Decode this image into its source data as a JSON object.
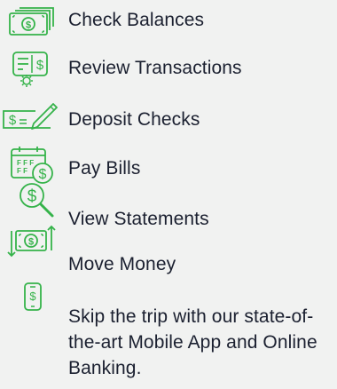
{
  "accent_color": "#35b34a",
  "text_color": "#1b2030",
  "background_color": "#f1f2f1",
  "features": [
    {
      "label": "Check Balances",
      "icon": "money-bills-icon"
    },
    {
      "label": "Review Transactions",
      "icon": "transaction-list-gear-icon"
    },
    {
      "label": "Deposit Checks",
      "icon": "check-pen-icon"
    },
    {
      "label": "Pay Bills",
      "icon": "calendar-dollar-icon"
    },
    {
      "label": "View Statements",
      "icon": "dollar-magnifier-icon"
    },
    {
      "label": "Move Money",
      "icon": "money-transfer-arrows-icon"
    },
    {
      "label": "Skip the trip with our state-of-the-art Mobile App and Online Banking.",
      "icon": "mobile-phone-dollar-icon"
    }
  ]
}
